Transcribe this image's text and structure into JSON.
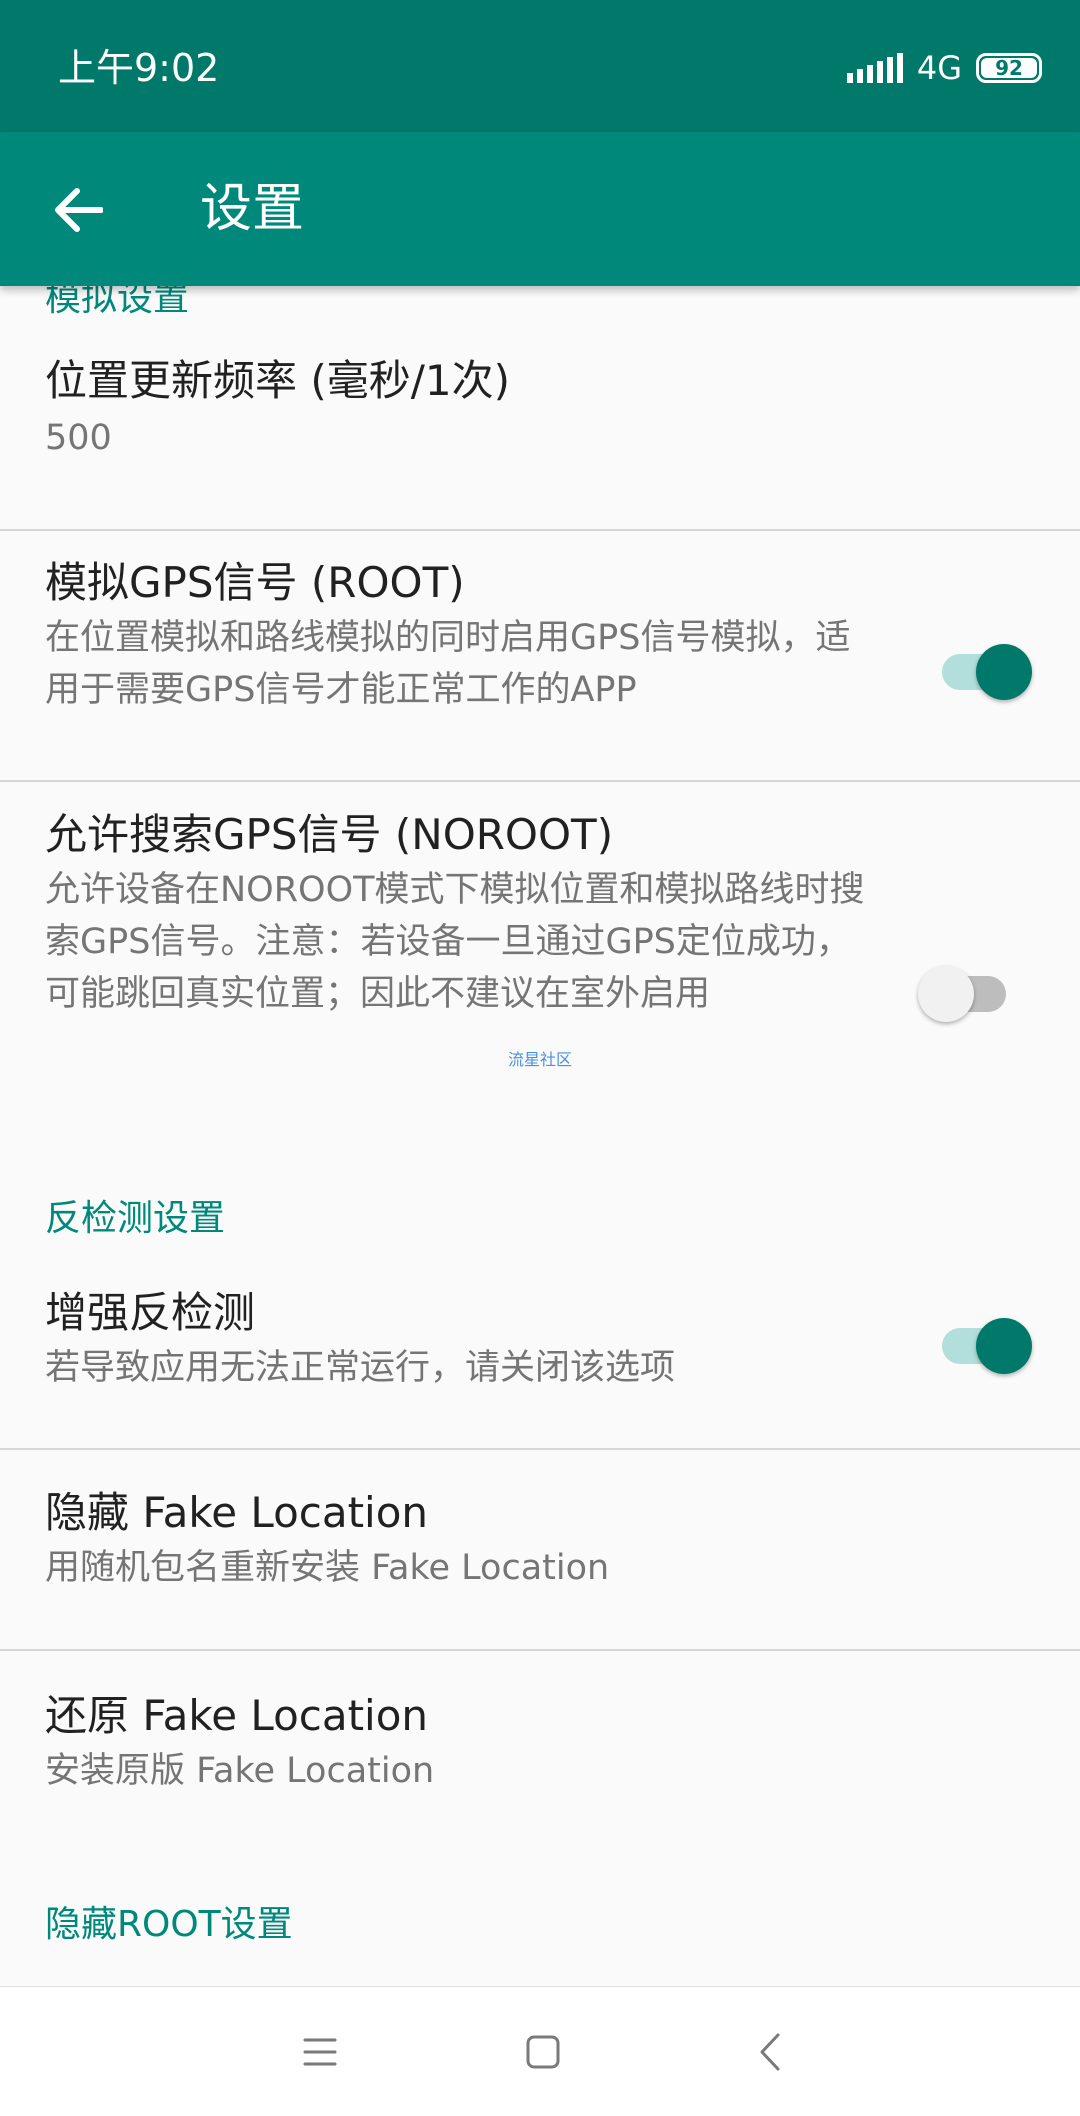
{
  "status_bar": {
    "time": "上午9:02",
    "network": "4G",
    "battery": "92"
  },
  "app_bar": {
    "title": "设置",
    "back_icon": "arrow-back-icon"
  },
  "sections": {
    "simulation_header": "模拟设置",
    "anti_detect_header": "反检测设置",
    "hide_root_header": "隐藏ROOT设置"
  },
  "prefs": {
    "update_rate": {
      "title": "位置更新频率 (毫秒/1次)",
      "summary": "500"
    },
    "mock_gps": {
      "title": "模拟GPS信号 (ROOT)",
      "summary": "在位置模拟和路线模拟的同时启用GPS信号模拟，适用于需要GPS信号才能正常工作的APP",
      "enabled": true
    },
    "allow_gps_search": {
      "title": "允许搜索GPS信号 (NOROOT)",
      "summary": "允许设备在NOROOT模式下模拟位置和模拟路线时搜索GPS信号。注意：若设备一旦通过GPS定位成功，可能跳回真实位置；因此不建议在室外启用",
      "enabled": false
    },
    "enhanced_anti_detect": {
      "title": "增强反检测",
      "summary": "若导致应用无法正常运行，请关闭该选项",
      "enabled": true
    },
    "hide_app": {
      "title": "隐藏 Fake Location",
      "summary": "用随机包名重新安装 Fake Location"
    },
    "restore_app": {
      "title": "还原 Fake Location",
      "summary": "安装原版 Fake Location"
    }
  },
  "watermark": "流星社区",
  "colors": {
    "status_bar": "#00796b",
    "app_bar": "#00897b",
    "accent": "#00897b"
  }
}
